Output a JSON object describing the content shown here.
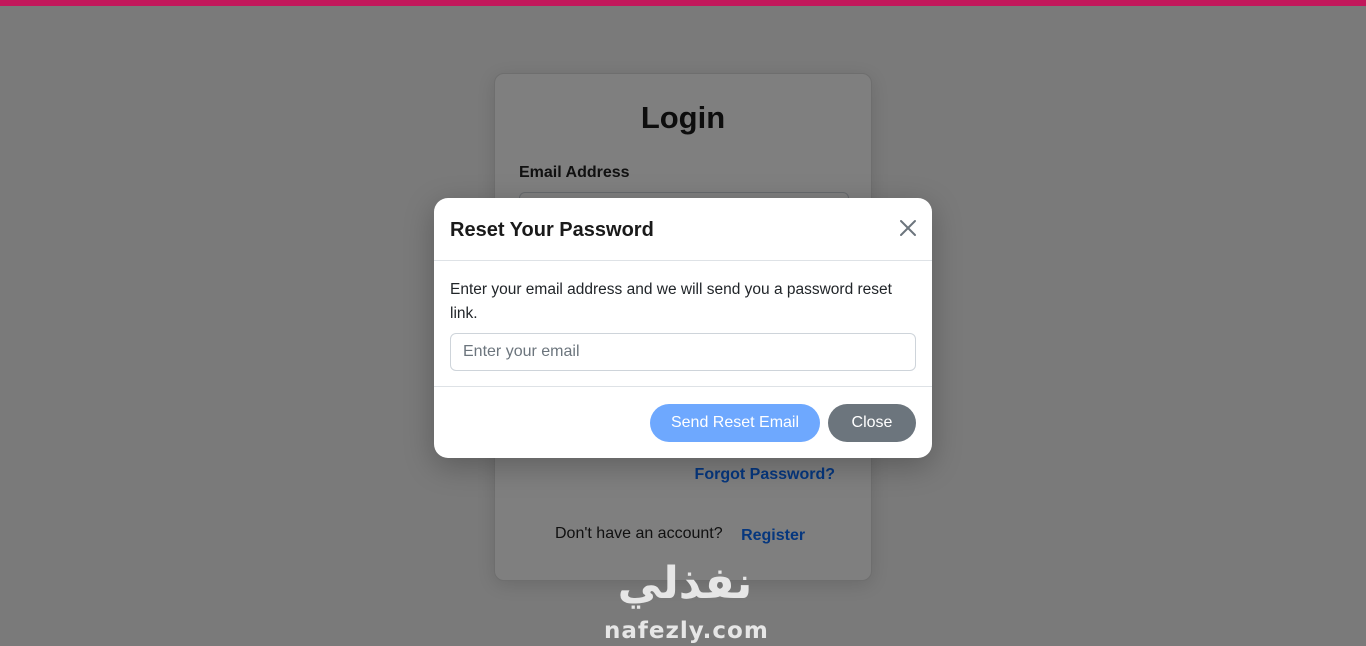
{
  "login": {
    "title": "Login",
    "email_label": "Email Address",
    "forgot_password": "Forgot Password?",
    "no_account_text": "Don't have an account?",
    "register_link": "Register"
  },
  "modal": {
    "title": "Reset Your Password",
    "description": "Enter your email address and we will send you a password reset link.",
    "email_placeholder": "Enter your email",
    "email_value": "",
    "send_button": "Send Reset Email",
    "close_button": "Close",
    "close_icon": "close-icon"
  },
  "watermark": {
    "arabic": "نفذلي",
    "latin": "nafezly.com"
  },
  "colors": {
    "top_bar": "#c2185b",
    "primary_link": "#0d6efd",
    "send_button": "#6ea8fe",
    "close_button": "#6c757d",
    "backdrop": "rgba(0,0,0,0.5)"
  }
}
